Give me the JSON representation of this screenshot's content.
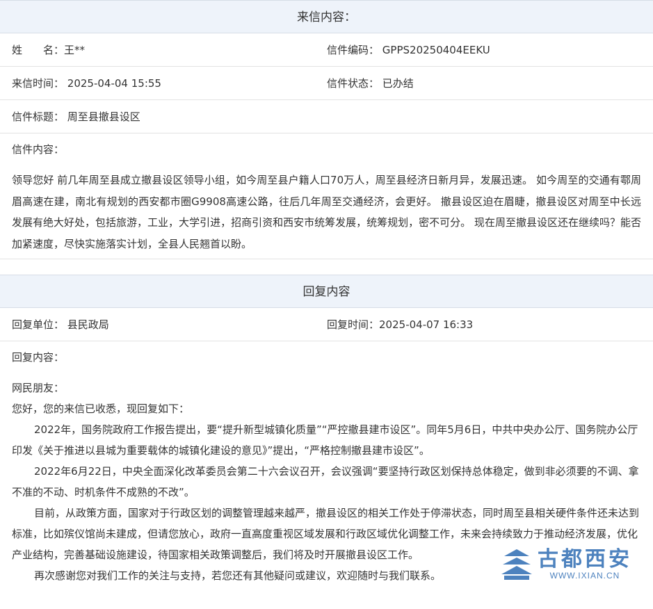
{
  "letter_section": {
    "header": "来信内容：",
    "name_label": "姓　　名：",
    "name_value": "王**",
    "code_label": "信件编码：",
    "code_value": "GPPS20250404EEKU",
    "time_label": "来信时间：",
    "time_value": "2025-04-04 15:55",
    "status_label": "信件状态：",
    "status_value": "已办结",
    "title_label": "信件标题：",
    "title_value": "周至县撤县设区",
    "content_label": "信件内容：",
    "content_text": "领导您好 前几年周至县成立撤县设区领导小组，如今周至县户籍人口70万人，周至县经济日新月异，发展迅速。 如今周至的交通有鄠周眉高速在建，南北有规划的西安都市圈G9908高速公路，往后几年周至交通经济，会更好。 撤县设区迫在眉睫，撤县设区对周至中长远发展有绝大好处，包括旅游，工业，大学引进，招商引资和西安市统筹发展，统筹规划，密不可分。 现在周至撤县设区还在继续吗？能否加紧速度，尽快实施落实计划，全县人民翘首以盼。"
  },
  "reply_section": {
    "header": "回复内容",
    "unit_label": "回复单位：",
    "unit_value": "县民政局",
    "time_label": "回复时间：",
    "time_value": "2025-04-07 16:33",
    "content_label": "回复内容：",
    "paragraphs": [
      "网民朋友：",
      "您好，您的来信已收悉，现回复如下：",
      "2022年，国务院政府工作报告提出，要“提升新型城镇化质量”“严控撤县建市设区”。同年5月6日，中共中央办公厅、国务院办公厅印发《关于推进以县城为重要载体的城镇化建设的意见》”提出，“严格控制撤县建市设区”。",
      "2022年6月22日，中央全面深化改革委员会第二十六会议召开，会议强调“要坚持行政区划保持总体稳定，做到非必须要的不调、拿不准的不动、时机条件不成熟的不改”。",
      "目前，从政策方面，国家对于行政区划的调整管理越来越严，撤县设区的相关工作处于停滞状态，同时周至县相关硬件条件还未达到标准，比如殡仪馆尚未建成，但请您放心，政府一直高度重视区域发展和行政区域优化调整工作，未来会持续致力于推动经济发展，优化产业结构，完善基础设施建设，待国家相关政策调整后，我们将及时开展撤县设区工作。",
      "再次感谢您对我们工作的关注与支持，若您还有其他疑问或建议，欢迎随时与我们联系。"
    ]
  },
  "watermark": {
    "title": "古都西安",
    "url": "WWW.IXIAN.CN",
    "color": "#2f6db3"
  }
}
